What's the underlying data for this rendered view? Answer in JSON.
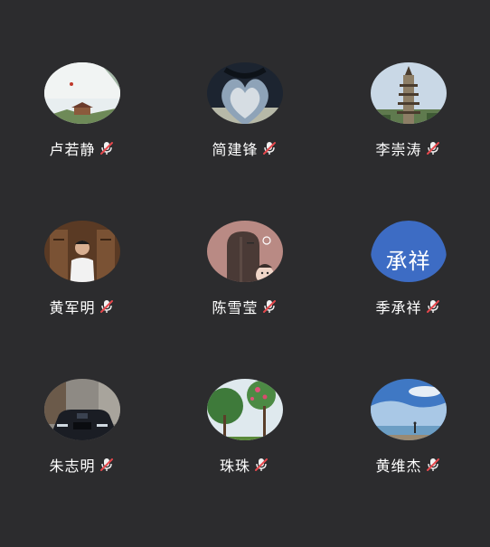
{
  "participants": [
    {
      "name": "卢若静",
      "avatar": "landscape-pavilion",
      "muted": true
    },
    {
      "name": "简建锋",
      "avatar": "heart-silhouette",
      "muted": true
    },
    {
      "name": "李崇涛",
      "avatar": "pagoda",
      "muted": true
    },
    {
      "name": "黄军明",
      "avatar": "man-portrait",
      "muted": true
    },
    {
      "name": "陈雪莹",
      "avatar": "illustration-girl",
      "muted": true
    },
    {
      "name": "季承祥",
      "avatar": "text-avatar",
      "avatar_text": "承祥",
      "avatar_color": "#3d6cc4",
      "muted": true
    },
    {
      "name": "朱志明",
      "avatar": "black-car",
      "muted": true
    },
    {
      "name": "珠珠",
      "avatar": "flowering-tree",
      "muted": true
    },
    {
      "name": "黄维杰",
      "avatar": "beach-sky",
      "muted": true
    }
  ],
  "colors": {
    "background": "#2c2c2e",
    "name_text": "#ffffff",
    "mic_muted": "#e5484d"
  }
}
